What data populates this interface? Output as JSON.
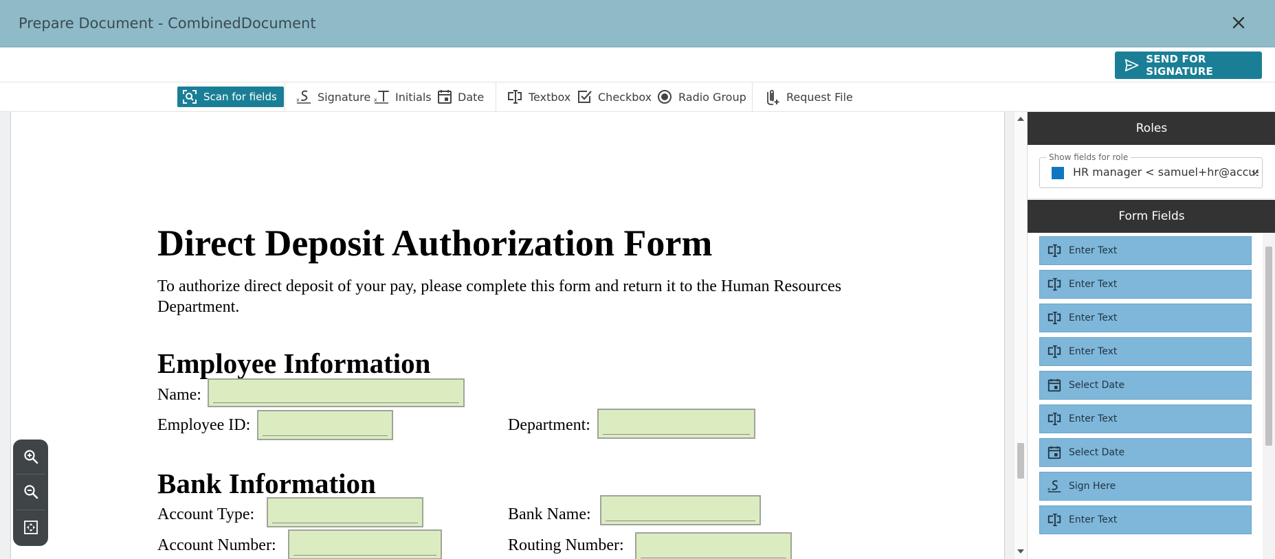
{
  "window": {
    "title": "Prepare Document - CombinedDocument",
    "close_icon": "close-icon"
  },
  "actions": {
    "send_label": "SEND FOR SIGNATURE"
  },
  "toolbar": {
    "scan_label": "Scan for fields",
    "signature": "Signature",
    "initials": "Initials",
    "date": "Date",
    "textbox": "Textbox",
    "checkbox": "Checkbox",
    "radio_group": "Radio Group",
    "request_file": "Request File"
  },
  "document": {
    "title": "Direct Deposit Authorization Form",
    "intro": "To authorize direct deposit of your pay, please complete this form and return it to the Human Resources Department.",
    "employee_heading": "Employee Information",
    "name_label": "Name:",
    "employee_id_label": "Employee ID:",
    "department_label": "Department:",
    "bank_heading": "Bank Information",
    "account_type_label": "Account Type:",
    "bank_name_label": "Bank Name:",
    "account_number_label": "Account Number:",
    "routing_number_label": "Routing Number:"
  },
  "roles_panel": {
    "heading": "Roles",
    "legend": "Show fields for role",
    "selected_role": "HR manager < samuel+hr@accusoft",
    "role_color": "#0f77c0"
  },
  "form_fields_panel": {
    "heading": "Form Fields",
    "items": [
      {
        "type": "textbox",
        "label": "Enter Text"
      },
      {
        "type": "textbox",
        "label": "Enter Text"
      },
      {
        "type": "textbox",
        "label": "Enter Text"
      },
      {
        "type": "textbox",
        "label": "Enter Text"
      },
      {
        "type": "date",
        "label": "Select Date"
      },
      {
        "type": "textbox",
        "label": "Enter Text"
      },
      {
        "type": "date",
        "label": "Select Date"
      },
      {
        "type": "signature",
        "label": "Sign Here"
      },
      {
        "type": "textbox",
        "label": "Enter Text"
      }
    ]
  },
  "colors": {
    "header": "#8fbbc8",
    "accent": "#1a7f96",
    "field_fill": "#dcecc1",
    "field_item": "#7fb7da"
  }
}
